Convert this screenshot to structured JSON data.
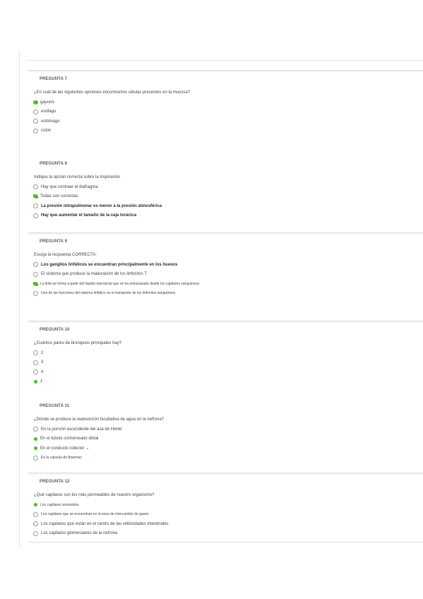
{
  "questions": [
    {
      "title": "PREGUNTA 7",
      "text": "¿En cuál de las siguientes opciones encontramos células presentes en la mucosa?",
      "options": [
        {
          "label": "gayuno",
          "state": "correct"
        },
        {
          "label": "esófago",
          "state": "none"
        },
        {
          "label": "estómago",
          "state": "none"
        },
        {
          "label": "colon",
          "state": "none"
        }
      ]
    },
    {
      "title": "PREGUNTA 8",
      "text": "Indique la opción correcta sobre la inspiración",
      "options": [
        {
          "label": "Hay que contraer el diafragma",
          "state": "none"
        },
        {
          "label": "Todas son correctas",
          "state": "correct"
        },
        {
          "label": "La presión intrapulmonar es menor a la presión atmosférica",
          "state": "none"
        },
        {
          "label": "Hay que aumentar el tamaño de la caja torácica",
          "state": "none"
        }
      ]
    },
    {
      "title": "PREGUNTA 9",
      "text": "Escoja la respuesta CORRECTA:",
      "options": [
        {
          "label": "Los ganglios linfáticos se encuentran principalmente en los huesos",
          "state": "none"
        },
        {
          "label": "El sistema que produce la maduración de los linfocitos T",
          "state": "none"
        },
        {
          "label": "La linfa se forma a partir del líquido intersticial que se ha extravasado desde los capilares sanguíneos",
          "state": "correct"
        },
        {
          "label": "Una de las funciones del sistema linfático es el transporte de los linfocitos sanguíneos",
          "state": "none"
        }
      ]
    },
    {
      "title": "PREGUNTA 10",
      "text": "¿Cuántos pares de bronquios principales hay?",
      "options": [
        {
          "label": "2",
          "state": "none"
        },
        {
          "label": "3",
          "state": "none"
        },
        {
          "label": "4",
          "state": "none"
        },
        {
          "label": "1",
          "state": "correct"
        }
      ]
    },
    {
      "title": "PREGUNTA 11",
      "text": "¿Dónde se produce la reabsorción facultativa de agua en la nefrona?",
      "options": [
        {
          "label": "En la porción ascendente del asa de Henle",
          "state": "none"
        },
        {
          "label": "En el túbulo contorneado distal",
          "state": "correct"
        },
        {
          "label": "En el conducto colector",
          "state": "correct",
          "tail": true
        },
        {
          "label": "En la cápsula de Bowman",
          "state": "none"
        }
      ]
    },
    {
      "title": "PREGUNTA 12",
      "text": "¿Qué capilares son los más permeables de nuestro organismo?",
      "options": [
        {
          "label": "Los capilares sinusoides",
          "state": "selected"
        },
        {
          "label": "Los capilares que se encuentran en la zona de intercambio de gases",
          "state": "none"
        },
        {
          "label": "Los capilares que están en el centro de las vellosidades intestinales",
          "state": "none"
        },
        {
          "label": "Los capilares glomerulares de la nefrona",
          "state": "none"
        }
      ]
    }
  ],
  "colors": {
    "correct": "#44c21f",
    "text": "#444444",
    "rule": "#dcdcdc"
  }
}
